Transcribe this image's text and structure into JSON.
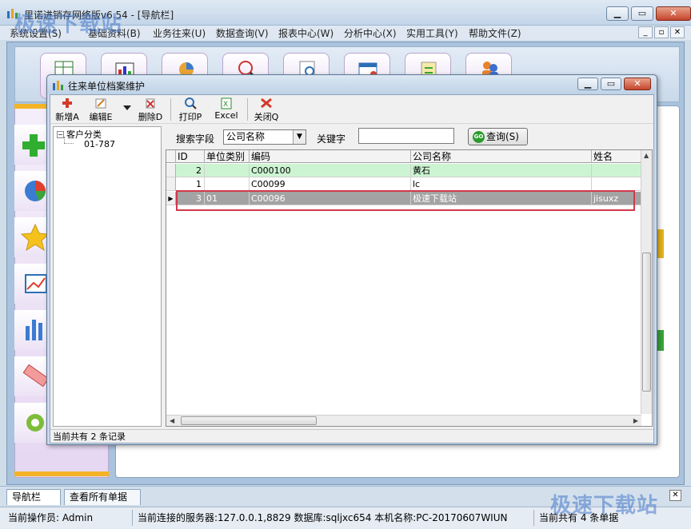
{
  "main_window": {
    "title": "里诺进销存网络版v6.54 - [导航栏]",
    "menus": [
      "系统设置(S)",
      "基础资料(B)",
      "业务往来(U)",
      "数据查询(V)",
      "报表中心(W)",
      "分析中心(X)",
      "实用工具(Y)",
      "帮助文件(Z)"
    ],
    "window_buttons": {
      "minimize": "▁",
      "maximize": "▭",
      "close": "✕"
    },
    "mdi_buttons": {
      "minimize": "_",
      "restore": "▫",
      "close": "✕"
    }
  },
  "watermark": "极速下载站",
  "dialog": {
    "title": "往来单位档案维护",
    "window_buttons": {
      "minimize": "▁",
      "maximize": "▭",
      "close": "✕"
    },
    "toolbar": {
      "add": "新增A",
      "edit": "编辑E",
      "delete": "删除D",
      "print": "打印P",
      "excel": "Excel",
      "close": "关闭Q"
    },
    "tree": {
      "root": "客户分类",
      "root_expander": "−",
      "child": "01-787"
    },
    "search": {
      "field_label": "搜索字段",
      "field_value": "公司名称",
      "keyword_label": "关键字",
      "keyword_value": "",
      "query_button": "查询(S)",
      "go_badge": "GO"
    },
    "grid": {
      "columns": [
        "ID",
        "单位类别",
        "编码",
        "公司名称",
        "姓名"
      ],
      "rows": [
        {
          "id": "2",
          "category": "",
          "code": "C000100",
          "company": "黄石",
          "name": "",
          "style": "green"
        },
        {
          "id": "1",
          "category": "",
          "code": "C00099",
          "company": "lc",
          "name": "",
          "style": "white"
        },
        {
          "id": "3",
          "category": "01",
          "code": "C00096",
          "company": "极速下载站",
          "name": "jisuxz",
          "style": "gray",
          "current": true
        }
      ],
      "current_row_marker": "▶"
    },
    "status": "当前共有 2 条记录"
  },
  "tabs": [
    {
      "label": "导航栏",
      "close": "✕"
    },
    {
      "label": "查看所有单据"
    }
  ],
  "tab_close": "✕",
  "statusbar": {
    "operator": "当前操作员: Admin",
    "connection": "当前连接的服务器:127.0.0.1,8829 数据库:sqljxc654 本机名称:PC-20170607WIUN",
    "records": "当前共有 4 条单据"
  },
  "colors": {
    "green_row": "#cdf4d2",
    "selected_row": "#a3a3a3",
    "highlight_border": "#d0394b",
    "orange_bar": "#f3b325"
  }
}
